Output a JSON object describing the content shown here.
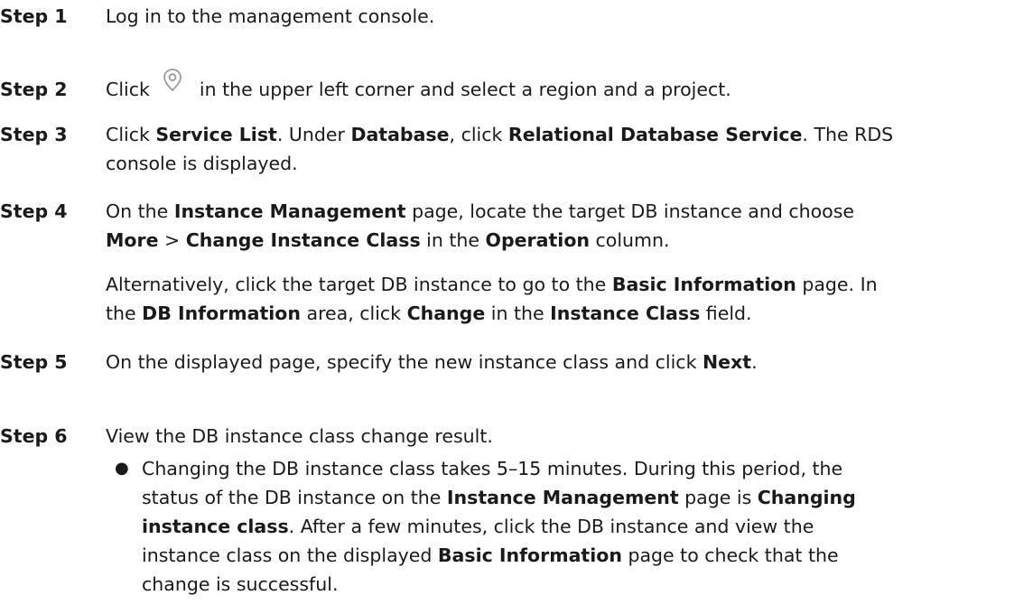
{
  "steps": [
    {
      "label": "Step 1",
      "text": "Log in to the management console."
    },
    {
      "label": "Step 2",
      "text_before_icon": "Click",
      "icon": "location-pin-icon",
      "text_after_icon": "in the upper left corner and select a region and a project."
    },
    {
      "label": "Step 3",
      "segments_line1": [
        "Click ",
        "Service List",
        ". Under ",
        "Database",
        ", click ",
        "Relational Database Service",
        ". The RDS"
      ],
      "line2": "console is displayed."
    },
    {
      "label": "Step 4",
      "segments_line1": [
        "On the ",
        "Instance Management",
        " page, locate the target DB instance and choose"
      ],
      "segments_line2": [
        "More",
        " > ",
        "Change Instance Class",
        " in the ",
        "Operation",
        " column."
      ],
      "alt_line1": [
        "Alternatively, click the target DB instance to go to the ",
        "Basic Information",
        " page. In"
      ],
      "alt_line2": [
        "the ",
        "DB Information",
        " area, click ",
        "Change",
        " in the ",
        "Instance Class",
        " field."
      ]
    },
    {
      "label": "Step 5",
      "segments": [
        "On the displayed page, specify the new instance class and click ",
        "Next",
        "."
      ]
    },
    {
      "label": "Step 6",
      "text": "View the DB instance class change result.",
      "bullet": "●",
      "bullet_line1": "Changing the DB instance class takes 5–15 minutes. During this period, the",
      "bullet_line2": [
        "status of the DB instance on the ",
        "Instance Management",
        " page is ",
        "Changing"
      ],
      "bullet_line3": [
        "instance class",
        ". After a few minutes, click the DB instance and view the"
      ],
      "bullet_line4": [
        "instance class on the displayed ",
        "Basic Information",
        " page to check that the"
      ],
      "bullet_line5": "change is successful."
    }
  ]
}
